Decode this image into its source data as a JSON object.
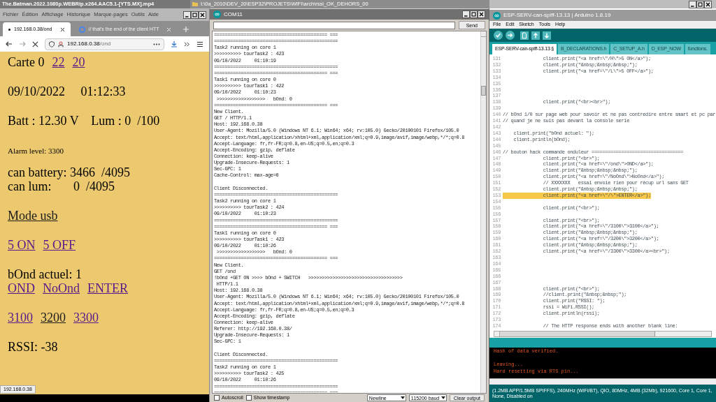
{
  "background_windows": [
    {
      "title": "The.Batman.2022.1080p.WEBRip.x264.AAC5.1-[YTS.MX].mp4"
    },
    {
      "title": "I:\\0a_2010\\DEV_20\\ESP32\\PROJETS\\WIFI\\arch\\rssi_OK_DEHORS_00"
    }
  ],
  "browser": {
    "menu": [
      "Fichier",
      "Édition",
      "Affichage",
      "Historique",
      "Marque-pages",
      "Outils",
      "Aide"
    ],
    "tabs": [
      {
        "label": "192.168.0.38/ond",
        "selected": true
      },
      {
        "label": "// that's the end of the client HTT",
        "selected": false
      }
    ],
    "url": {
      "host": "192.168.0.38",
      "path": "/ond"
    },
    "paragraphs": [
      {
        "kind": "normal",
        "lines": [
          [
            {
              "kind": "text",
              "text": "Carte 0"
            },
            {
              "kind": "link",
              "text": "22",
              "visited": true
            },
            {
              "kind": "link",
              "text": "20",
              "visited": true
            }
          ]
        ]
      },
      {
        "kind": "normal",
        "lines": [
          [
            {
              "kind": "text",
              "text": "09/10/2022     01:12:33"
            }
          ]
        ]
      },
      {
        "kind": "normal",
        "lines": [
          [
            {
              "kind": "text",
              "text": "Batt : 12.30 V    Lum : 0  /100"
            }
          ]
        ]
      },
      {
        "kind": "small",
        "lines": [
          [
            {
              "kind": "text",
              "text": "Alarm level: 3300"
            }
          ]
        ]
      },
      {
        "kind": "normal",
        "lines": [
          [
            {
              "kind": "text",
              "text": "can battery: 3466  /4095"
            }
          ],
          [
            {
              "kind": "text",
              "text": "can lum:       0  /4095"
            }
          ]
        ]
      },
      {
        "kind": "normal",
        "lines": [
          [
            {
              "kind": "link",
              "text": "Mode usb",
              "visited": false
            }
          ]
        ]
      },
      {
        "kind": "normal",
        "lines": [
          [
            {
              "kind": "link",
              "text": "5 ON",
              "visited": true
            },
            {
              "kind": "link",
              "text": "5 OFF",
              "visited": true
            }
          ]
        ]
      },
      {
        "kind": "normal",
        "lines": [
          [
            {
              "kind": "text",
              "text": "bOnd actuel: 1"
            }
          ],
          [
            {
              "kind": "link",
              "text": "OND",
              "visited": true
            },
            {
              "kind": "link",
              "text": "NoOnd",
              "visited": true
            },
            {
              "kind": "link",
              "text": "ENTER",
              "visited": true
            }
          ]
        ]
      },
      {
        "kind": "normal",
        "lines": [
          [
            {
              "kind": "link",
              "text": "3100",
              "visited": true
            },
            {
              "kind": "link",
              "text": "3200",
              "visited": false
            },
            {
              "kind": "link",
              "text": "3300",
              "visited": true
            }
          ]
        ]
      },
      {
        "kind": "normal",
        "lines": [
          [
            {
              "kind": "text",
              "text": "RSSI: -38"
            }
          ]
        ]
      }
    ],
    "status": "192.168.0.38"
  },
  "serial": {
    "title": "COM11",
    "send": "Send",
    "chunks": [
      [
        "========================================== ===",
        "==============================================",
        "Task2 running on core 1",
        ">>>>>>>>>> tourTask2 : 423",
        "09/10/2022     01:10:19",
        "==============================================",
        "========================================== ===",
        "Task1 running on core 0",
        ">>>>>>>>>> tourTask1 : 422",
        "09/10/2022     01:10:23",
        " >>>>>>>>>>>>>>>>>>   bOnd: 0",
        "========================================== ===",
        "New Client.",
        "GET / HTTP/1.1",
        "Host: 192.168.0.38",
        "User-Agent: Mozilla/5.0 (Windows NT 6.1; Win64; x64; rv:105.0) Gecko/20100101 Firefox/105.0",
        "Accept: text/html,application/xhtml+xml,application/xml;q=0.9,image/avif,image/webp,*/*;q=0.8",
        "Accept-Language: fr,fr-FR;q=0.8,en-US;q=0.5,en;q=0.3",
        "Accept-Encoding: gzip, deflate",
        "Connection: keep-alive",
        "Upgrade-Insecure-Requests: 1",
        "Sec-GPC: 1",
        "Cache-Control: max-age=0"
      ],
      [
        "Client Disconnected.",
        "==============================================",
        "Task2 running on core 1",
        ">>>>>>>>>> tourTask2 : 424",
        "09/10/2022     01:10:23",
        "==============================================",
        "========================================== ===",
        "Task1 running on core 0",
        ">>>>>>>>>> tourTask1 : 423",
        "09/10/2022     01:10:26",
        " >>>>>>>>>>>>>>>>>>   bOnd: 0",
        "========================================== ===",
        "New Client.",
        "GET /ond",
        "!bOnd +GET ON >>>> bOnd + SWITCH   >>>>>>>>>>>>>>>>>>>>>>>>>>>>>>>>>>>",
        " HTTP/1.1",
        "Host: 192.168.0.38",
        "User-Agent: Mozilla/5.0 (Windows NT 6.1; Win64; x64; rv:105.0) Gecko/20100101 Firefox/105.0",
        "Accept: text/html,application/xhtml+xml,application/xml;q=0.9,image/avif,image/webp,*/*;q=0.8",
        "Accept-Language: fr,fr-FR;q=0.8,en-US;q=0.5,en;q=0.3",
        "Accept-Encoding: gzip, deflate",
        "Connection: keep-alive",
        "Referer: http://192.168.0.38/",
        "Upgrade-Insecure-Requests: 1",
        "Sec-GPC: 1"
      ],
      [
        "Client Disconnected.",
        "==============================================",
        "Task2 running on core 1",
        ">>>>>>>>>> tourTask2 : 425",
        "09/10/2022     01:10:26",
        "==============================================",
        "========================================== ==="
      ]
    ],
    "autoscroll": {
      "label": "Autoscroll",
      "checked": false
    },
    "timestamp": {
      "label": "Show timestamp",
      "checked": false
    },
    "line_ending": "Newline",
    "baud": "115200 baud",
    "clear": "Clear output"
  },
  "ide": {
    "title": "ESP-SERV-can-spiff-13.13 | Arduino 1.8.19",
    "menu": [
      "File",
      "Edit",
      "Sketch",
      "Tools",
      "Help"
    ],
    "tabs": [
      {
        "label": "ESP-SERV-can-spiff-13.13 §",
        "selected": true
      },
      {
        "label": "B_DECLARATIONS.h",
        "selected": false
      },
      {
        "label": "C_SETUP_A.h",
        "selected": false
      },
      {
        "label": "D_ESP_NOW",
        "selected": false
      },
      {
        "label": "functions.",
        "selected": false
      }
    ],
    "code": [
      {
        "number": "131",
        "code": "               client.print(\"<a href=\\\"/H\\\">5 ON</a>\");",
        "highlighted": false
      },
      {
        "number": "132",
        "code": "               client.print(\"&nbsp;&nbsp;&nbsp;\");",
        "highlighted": false
      },
      {
        "number": "133",
        "code": "               client.print(\"<a href=\\\"/L\\\">5 OFF</a>\");",
        "highlighted": false
      },
      {
        "number": "134",
        "highlighted": false
      },
      {
        "number": "135",
        "highlighted": false
      },
      {
        "number": "136",
        "highlighted": false
      },
      {
        "number": "137",
        "highlighted": false
      },
      {
        "number": "138",
        "code": "               client.print(\"<br><br>\");",
        "highlighted": false
      },
      {
        "number": "139",
        "highlighted": false
      },
      {
        "number": "140",
        "code": "// bOnd 1/0 sur page web pour savoir et ne pas contredire entre smart et pc par",
        "highlighted": false
      },
      {
        "number": "141",
        "code": "// quand je ne suis pas devant la console serie",
        "highlighted": false
      },
      {
        "number": "142",
        "highlighted": false
      },
      {
        "number": "143",
        "code": "    client.print(\"bOnd actuel: \");",
        "highlighted": false
      },
      {
        "number": "144",
        "code": "    client.println(bOnd);",
        "highlighted": false
      },
      {
        "number": "145",
        "highlighted": false
      },
      {
        "number": "146",
        "code": "// bouton hack commande onduleur ==================================",
        "highlighted": false
      },
      {
        "number": "147",
        "code": "               client.print(\"<br>\");",
        "highlighted": false
      },
      {
        "number": "148",
        "code": "               client.print(\"<a href=\\\"/ond\\\">OND</a>\");",
        "highlighted": false
      },
      {
        "number": "149",
        "code": "               client.print(\"&nbsp;&nbsp;&nbsp;\");",
        "highlighted": false
      },
      {
        "number": "150",
        "code": "               client.print(\"<a href=\\\"/NoOnd\\\">NoOnd</a>\");",
        "highlighted": false
      },
      {
        "number": "151",
        "code": "               // XXXXXXX   essai envoie rien pour récup url sans GET",
        "highlighted": false
      },
      {
        "number": "152",
        "code": "               client.print(\"&nbsp;&nbsp;&nbsp;\");",
        "highlighted": false
      },
      {
        "number": "153",
        "code": "               client.print(\"<a href=\\\"/\\\">ENTER</a>\");",
        "highlighted": true
      },
      {
        "number": "154",
        "highlighted": false
      },
      {
        "number": "155",
        "code": "               client.print(\"<br>\");",
        "highlighted": false
      },
      {
        "number": "156",
        "highlighted": false
      },
      {
        "number": "157",
        "code": "               client.print(\"<br>\");",
        "highlighted": false
      },
      {
        "number": "158",
        "code": "               client.print(\"<a href=\\\"/3100\\\">3100</a>\");",
        "highlighted": false
      },
      {
        "number": "159",
        "code": "               client.print(\"&nbsp;&nbsp;&nbsp;\");",
        "highlighted": false
      },
      {
        "number": "160",
        "code": "               client.print(\"<a href=\\\"/3200\\\">3200</a>\");",
        "highlighted": false
      },
      {
        "number": "161",
        "code": "               client.print(\"&nbsp;&nbsp;&nbsp;\");",
        "highlighted": false
      },
      {
        "number": "162",
        "code": "               client.print(\"<a href=\\\"/3300\\\">3300</a><br>\");",
        "highlighted": false
      },
      {
        "number": "163",
        "highlighted": false
      },
      {
        "number": "164",
        "highlighted": false
      },
      {
        "number": "165",
        "highlighted": false
      },
      {
        "number": "166",
        "highlighted": false
      },
      {
        "number": "167",
        "highlighted": false
      },
      {
        "number": "168",
        "code": "               client.print(\"<br>\");",
        "highlighted": false
      },
      {
        "number": "169",
        "code": "               //client.print(\"&nbsp;&nbsp;\");",
        "highlighted": false
      },
      {
        "number": "170",
        "code": "               client.print(\"RSSI: \");",
        "highlighted": false
      },
      {
        "number": "171",
        "code": "               rssi = WiFi.RSSI();",
        "highlighted": false
      },
      {
        "number": "172",
        "code": "               client.println(rssi);",
        "highlighted": false
      },
      {
        "number": "173",
        "highlighted": false
      },
      {
        "number": "174",
        "code": "               // The HTTP response ends with another blank line:",
        "highlighted": false
      }
    ],
    "console": [
      "Hash of data verified.",
      "Leaving...",
      "Hard resetting via RTS pin..."
    ],
    "status": "(1.2MB APP/1.5MB SPIFFS), 240MHz (WiFi/BT), QIO, 80MHz, 4MB (32Mb), 921600, Core 1, Core 1, None, Disabled on"
  }
}
